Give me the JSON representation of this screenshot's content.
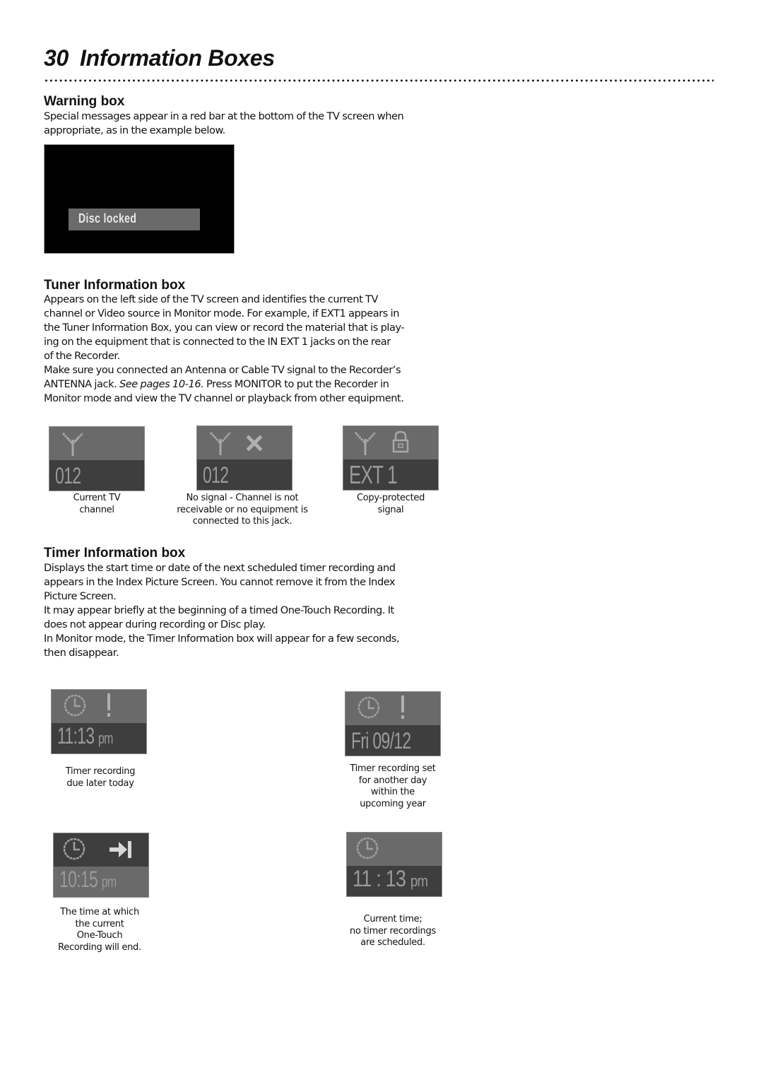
{
  "page": {
    "number": "30",
    "title": "Information Boxes"
  },
  "warning": {
    "heading": "Warning box",
    "lines": [
      "Special messages appear in a red bar at the bottom of the TV screen when",
      "appropriate, as in the example below."
    ],
    "screen_message": "Disc locked"
  },
  "tuner": {
    "heading": "Tuner Information box",
    "lines": [
      "Appears on the left side of the TV screen and identifies the current TV",
      "channel or  Video source in Monitor mode. For example, if EXT1 appears in",
      "the Tuner Information Box, you can view or record the material that is play-",
      "ing on the equipment that is connected to the IN EXT 1 jacks on the rear",
      "of the Recorder.",
      "Make sure you connected an Antenna or Cable TV signal to the Recorder’s"
    ],
    "line7_a": "ANTENNA jack. ",
    "line7_italic": "See pages 10-16.",
    "line7_b": " Press MONITOR to put the Recorder in",
    "line8": "Monitor mode and view the TV channel or playback from other equipment.",
    "boxes": [
      {
        "icons": [
          "antenna-icon"
        ],
        "readout": "012",
        "caption": [
          "Current TV",
          "channel"
        ]
      },
      {
        "icons": [
          "antenna-icon",
          "no-signal-x-icon"
        ],
        "readout": "012",
        "caption": [
          "No signal - Channel is not",
          "receivable or no equipment is",
          "connected to this jack."
        ]
      },
      {
        "icons": [
          "antenna-icon",
          "lock-icon"
        ],
        "readout": "EXT 1",
        "caption": [
          "Copy-protected",
          "signal"
        ]
      }
    ]
  },
  "timer": {
    "heading": "Timer Information box",
    "lines": [
      "Displays the start time or date of the next scheduled timer recording and",
      "appears in the Index Picture Screen. You cannot remove it from the Index",
      "Picture Screen.",
      "It may appear briefly at the beginning of a timed One-Touch Recording. It",
      "does not appear during recording or Disc play.",
      "In Monitor mode, the Timer Information box will appear for a few seconds,",
      "then disappear."
    ],
    "boxes": [
      {
        "icons": [
          "clock-icon",
          "exclamation-icon"
        ],
        "readout_main": "11:13",
        "readout_suffix": "pm",
        "caption": [
          "Timer recording",
          "due later today"
        ]
      },
      {
        "icons": [
          "clock-icon",
          "exclamation-icon"
        ],
        "readout_main": "Fri 09/12",
        "readout_suffix": "",
        "caption": [
          "Timer recording set",
          "for another day",
          "within the",
          "upcoming year"
        ]
      },
      {
        "icons": [
          "clock-icon",
          "skip-to-end-arrow-icon"
        ],
        "readout_main": "10:15",
        "readout_suffix": "pm",
        "caption": [
          "The time at which",
          "the current",
          "One-Touch",
          "Recording will end."
        ]
      },
      {
        "icons": [
          "clock-icon"
        ],
        "readout_main": "11 : 13",
        "readout_suffix": "pm",
        "caption": [
          "Current time;",
          "no timer recordings",
          "are scheduled."
        ]
      }
    ]
  }
}
